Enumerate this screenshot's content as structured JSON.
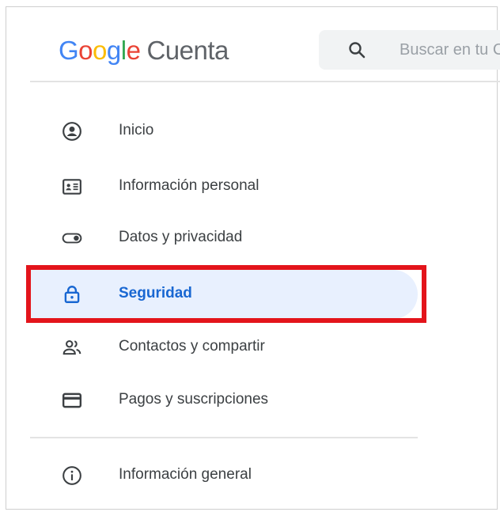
{
  "header": {
    "logo": {
      "brand_letters": [
        "G",
        "o",
        "o",
        "g",
        "l",
        "e"
      ],
      "product": "Cuenta"
    },
    "search": {
      "placeholder": "Buscar en tu Cuenta de Google"
    }
  },
  "sidebar": {
    "items": [
      {
        "label": "Inicio",
        "icon": "account-circle-icon",
        "active": false
      },
      {
        "label": "Información personal",
        "icon": "id-card-icon",
        "active": false
      },
      {
        "label": "Datos y privacidad",
        "icon": "toggle-icon",
        "active": false
      },
      {
        "label": "Seguridad",
        "icon": "lock-icon",
        "active": true
      },
      {
        "label": "Contactos y compartir",
        "icon": "people-icon",
        "active": false
      },
      {
        "label": "Pagos y suscripciones",
        "icon": "credit-card-icon",
        "active": false
      }
    ],
    "footer_items": [
      {
        "label": "Información general",
        "icon": "info-icon",
        "active": false
      }
    ]
  },
  "annotation": {
    "highlight_color": "#e3141b",
    "highlighted_item": "Seguridad"
  },
  "colors": {
    "active_bg": "#e8f0fe",
    "active_text": "#1967d2",
    "text": "#3c4043",
    "icon": "#5f6368"
  }
}
